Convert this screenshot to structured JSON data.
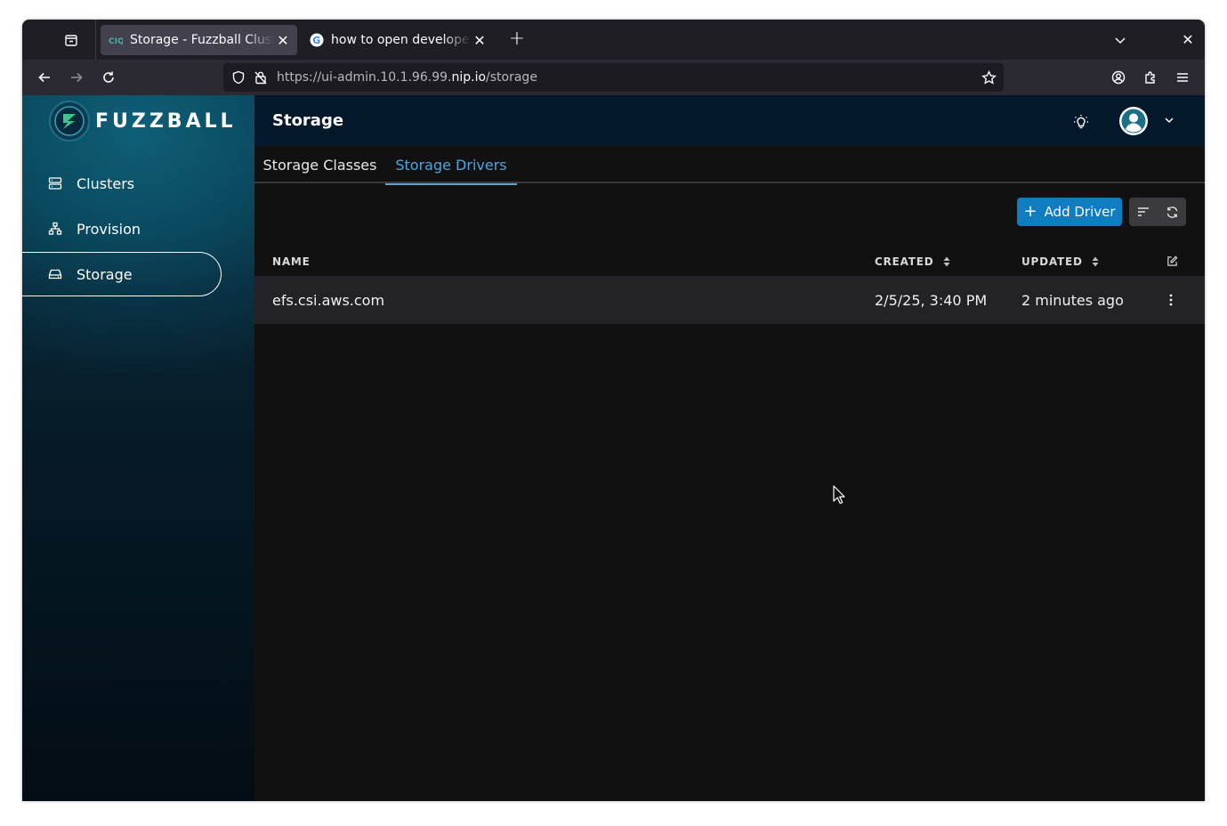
{
  "browser": {
    "tabs": [
      {
        "title": "Storage - Fuzzball Cluster Admin",
        "active": true
      },
      {
        "title": "how to open developer tools",
        "active": false
      }
    ],
    "url": {
      "prefix": "https://ui-admin.10.1.96.99.",
      "host": "nip.io",
      "path": "/storage"
    }
  },
  "app": {
    "logo_text": "FUZZBALL",
    "sidebar": {
      "items": [
        {
          "label": "Clusters",
          "icon": "server-icon"
        },
        {
          "label": "Provision",
          "icon": "sitemap-icon"
        },
        {
          "label": "Storage",
          "icon": "hard-drive-icon",
          "active": true
        }
      ]
    },
    "header": {
      "title": "Storage"
    },
    "tabs": [
      {
        "label": "Storage Classes",
        "active": false
      },
      {
        "label": "Storage Drivers",
        "active": true
      }
    ],
    "toolbar": {
      "add_label": "Add Driver"
    },
    "table": {
      "columns": [
        "NAME",
        "CREATED",
        "UPDATED"
      ],
      "rows": [
        {
          "name": "efs.csi.aws.com",
          "created": "2/5/25, 3:40 PM",
          "updated": "2 minutes ago"
        }
      ]
    }
  },
  "colors": {
    "accent": "#4ea6de",
    "primary_button": "#0f7dbf",
    "header_bg": "#03182a"
  }
}
